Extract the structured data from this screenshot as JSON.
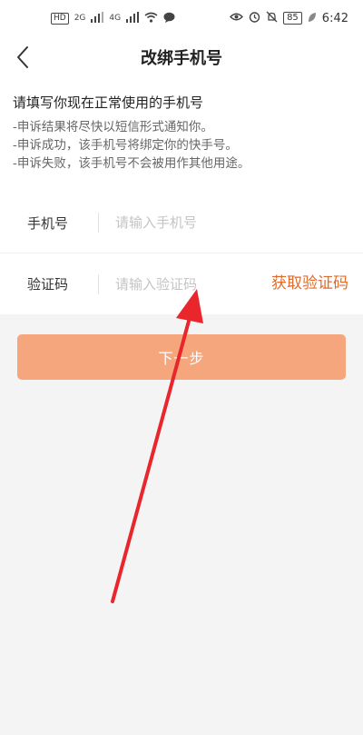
{
  "status_bar": {
    "hd_badge": "HD",
    "net_1": "2G",
    "net_2": "4G",
    "battery": "85",
    "time": "6:42"
  },
  "nav": {
    "title": "改绑手机号",
    "back_icon": "chevron-left-icon"
  },
  "notice": {
    "title": "请填写你现在正常使用的手机号",
    "lines": [
      "-申诉结果将尽快以短信形式通知你。",
      "-申诉成功，该手机号将绑定你的快手号。",
      "-申诉失败，该手机号不会被用作其他用途。"
    ]
  },
  "form": {
    "phone_label": "手机号",
    "phone_placeholder": "请输入手机号",
    "code_label": "验证码",
    "code_placeholder": "请输入验证码",
    "get_code_label": "获取验证码"
  },
  "next_button": {
    "label": "下一步"
  },
  "colors": {
    "accent": "#e3692b",
    "button_disabled": "#f6a67d",
    "annotation_arrow": "#e8262b"
  }
}
